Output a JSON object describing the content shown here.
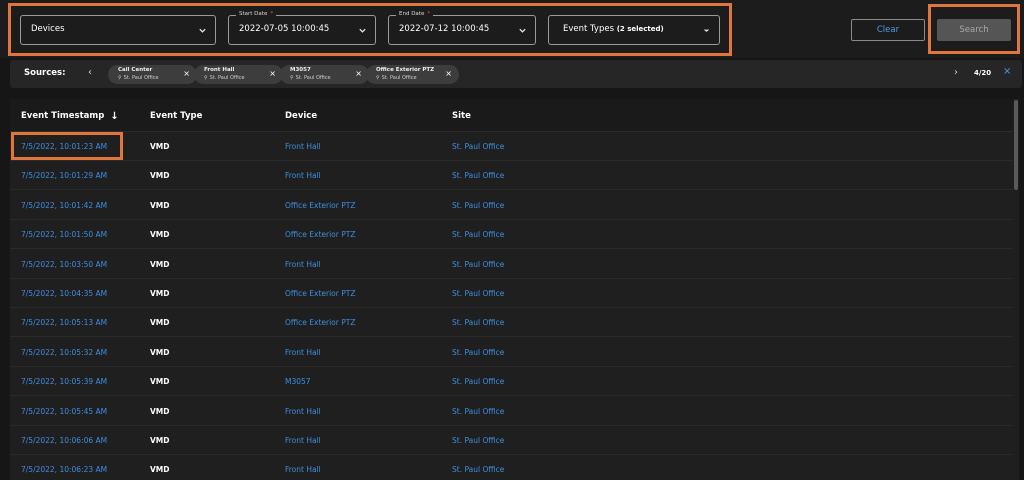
{
  "filters": {
    "devices": {
      "value": "Devices",
      "icon": "chevron-down-icon"
    },
    "start_date": {
      "label": "Start Date",
      "required_mark": "*",
      "value": "2022-07-05 10:00:45"
    },
    "end_date": {
      "label": "End Date",
      "required_mark": "*",
      "value": "2022-07-12 10:00:45"
    },
    "event_types": {
      "value": "Event Types",
      "count_text": "(2 selected)"
    },
    "clear_label": "Clear",
    "search_label": "Search"
  },
  "sources": {
    "label": "Sources:",
    "chips": [
      {
        "name": "Call Center",
        "site": "St. Paul Office"
      },
      {
        "name": "Front Hall",
        "site": "St. Paul Office"
      },
      {
        "name": "M3057",
        "site": "St. Paul Office"
      },
      {
        "name": "Office Exterior PTZ",
        "site": "St. Paul Office"
      }
    ],
    "pager": "4/20",
    "close_glyph": "×",
    "prev_glyph": "‹",
    "next_glyph": "›"
  },
  "table": {
    "columns": [
      "Event Timestamp",
      "Event Type",
      "Device",
      "Site"
    ],
    "sort_glyph": "↓",
    "rows": [
      {
        "timestamp": "7/5/2022, 10:01:23 AM",
        "type": "VMD",
        "device": "Front Hall",
        "site": "St. Paul Office"
      },
      {
        "timestamp": "7/5/2022, 10:01:29 AM",
        "type": "VMD",
        "device": "Front Hall",
        "site": "St. Paul Office"
      },
      {
        "timestamp": "7/5/2022, 10:01:42 AM",
        "type": "VMD",
        "device": "Office Exterior PTZ",
        "site": "St. Paul Office"
      },
      {
        "timestamp": "7/5/2022, 10:01:50 AM",
        "type": "VMD",
        "device": "Office Exterior PTZ",
        "site": "St. Paul Office"
      },
      {
        "timestamp": "7/5/2022, 10:03:50 AM",
        "type": "VMD",
        "device": "Front Hall",
        "site": "St. Paul Office"
      },
      {
        "timestamp": "7/5/2022, 10:04:35 AM",
        "type": "VMD",
        "device": "Office Exterior PTZ",
        "site": "St. Paul Office"
      },
      {
        "timestamp": "7/5/2022, 10:05:13 AM",
        "type": "VMD",
        "device": "Office Exterior PTZ",
        "site": "St. Paul Office"
      },
      {
        "timestamp": "7/5/2022, 10:05:32 AM",
        "type": "VMD",
        "device": "Front Hall",
        "site": "St. Paul Office"
      },
      {
        "timestamp": "7/5/2022, 10:05:39 AM",
        "type": "VMD",
        "device": "M3057",
        "site": "St. Paul Office"
      },
      {
        "timestamp": "7/5/2022, 10:05:45 AM",
        "type": "VMD",
        "device": "Front Hall",
        "site": "St. Paul Office"
      },
      {
        "timestamp": "7/5/2022, 10:06:06 AM",
        "type": "VMD",
        "device": "Front Hall",
        "site": "St. Paul Office"
      },
      {
        "timestamp": "7/5/2022, 10:06:23 AM",
        "type": "VMD",
        "device": "Front Hall",
        "site": "St. Paul Office"
      }
    ]
  },
  "colors": {
    "highlight": "#e0763a",
    "link": "#3f8ee0",
    "background": "#161616"
  }
}
